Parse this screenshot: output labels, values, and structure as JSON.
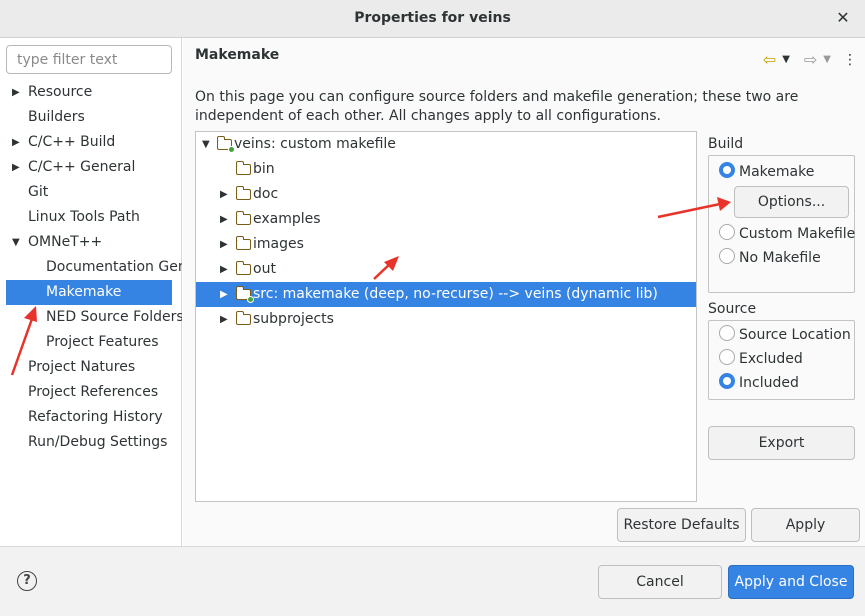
{
  "window": {
    "title": "Properties for veins",
    "close_glyph": "✕"
  },
  "sidebar": {
    "filter_placeholder": "type filter text",
    "items": [
      {
        "label": "Resource",
        "expander": "▶"
      },
      {
        "label": "Builders",
        "expander": ""
      },
      {
        "label": "C/C++ Build",
        "expander": "▶"
      },
      {
        "label": "C/C++ General",
        "expander": "▶"
      },
      {
        "label": "Git",
        "expander": ""
      },
      {
        "label": "Linux Tools Path",
        "expander": ""
      },
      {
        "label": "OMNeT++",
        "expander": "▼"
      },
      {
        "label": "Documentation Generator",
        "expander": ""
      },
      {
        "label": "Makemake",
        "expander": "",
        "selected": true
      },
      {
        "label": "NED Source Folders",
        "expander": ""
      },
      {
        "label": "Project Features",
        "expander": ""
      },
      {
        "label": "Project Natures",
        "expander": ""
      },
      {
        "label": "Project References",
        "expander": ""
      },
      {
        "label": "Refactoring History",
        "expander": ""
      },
      {
        "label": "Run/Debug Settings",
        "expander": ""
      }
    ]
  },
  "main": {
    "title": "Makemake",
    "description": "On this page you can configure source folders and makefile generation; these two are independent of each other. All changes apply to all configurations.",
    "history": {
      "back": "⇦",
      "back_menu": "▼",
      "forward": "⇨",
      "forward_menu": "▼",
      "more": "⋮"
    },
    "tree": {
      "root": {
        "label": "veins: custom makefile",
        "expander": "▼"
      },
      "children": [
        {
          "label": "bin",
          "expander": ""
        },
        {
          "label": "doc",
          "expander": "▶"
        },
        {
          "label": "examples",
          "expander": "▶"
        },
        {
          "label": "images",
          "expander": "▶"
        },
        {
          "label": "out",
          "expander": "▶"
        },
        {
          "label": "src: makemake (deep, no-recurse) --> veins (dynamic lib)",
          "expander": "▶",
          "selected": true
        },
        {
          "label": "subprojects",
          "expander": "▶"
        }
      ]
    },
    "build_group": {
      "legend": "Build",
      "options": [
        {
          "label": "Makemake",
          "selected": true
        },
        {
          "label": "Custom Makefile",
          "selected": false
        },
        {
          "label": "No Makefile",
          "selected": false
        }
      ],
      "options_button": "Options..."
    },
    "source_group": {
      "legend": "Source",
      "options": [
        {
          "label": "Source Location",
          "selected": false
        },
        {
          "label": "Excluded",
          "selected": false
        },
        {
          "label": "Included",
          "selected": true
        }
      ]
    },
    "export_button": "Export",
    "restore_defaults_button": "Restore Defaults",
    "apply_button": "Apply"
  },
  "footer": {
    "help_glyph": "?",
    "cancel_button": "Cancel",
    "apply_close_button": "Apply and Close"
  },
  "colors": {
    "accent": "#3584e4",
    "annotation_arrow": "#e8332a"
  }
}
